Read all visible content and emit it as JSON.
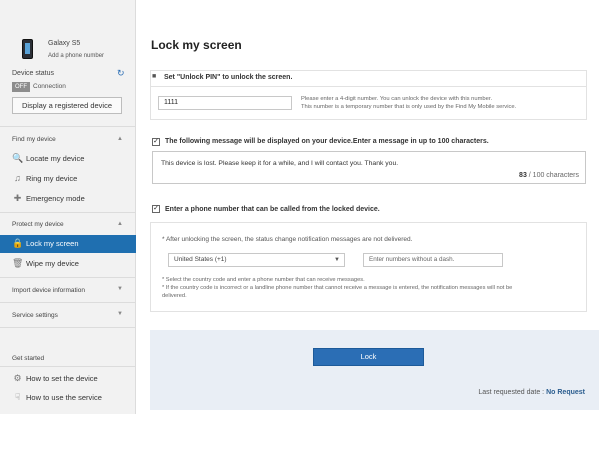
{
  "sidebar": {
    "device_name": "Galaxy S5",
    "add_phone": "Add a phone number",
    "status_label": "Device status",
    "status_badge": "OFF",
    "status_text": "Connection",
    "display_button": "Display a registered device",
    "find": {
      "title": "Find my device",
      "items": [
        {
          "label": "Locate my device",
          "icon": "search-icon"
        },
        {
          "label": "Ring my device",
          "icon": "music-note-icon"
        },
        {
          "label": "Emergency mode",
          "icon": "emergency-icon"
        }
      ]
    },
    "protect": {
      "title": "Protect my device",
      "items": [
        {
          "label": "Lock my screen",
          "icon": "lock-icon",
          "active": true
        },
        {
          "label": "Wipe my device",
          "icon": "trash-icon"
        }
      ]
    },
    "import_title": "Import device information",
    "service_title": "Service settings",
    "get_started": {
      "title": "Get started",
      "items": [
        {
          "label": "How to set the device",
          "icon": "gear-icon"
        },
        {
          "label": "How to use the service",
          "icon": "hand-icon"
        }
      ]
    }
  },
  "main": {
    "title": "Lock my screen",
    "pin": {
      "heading": "Set \"Unlock PIN\" to unlock the screen.",
      "value": "1111",
      "hint1": "Please enter a 4-digit number. You can unlock the device with this number.",
      "hint2": "This number is a temporary number that is only used by the Find My Mobile service."
    },
    "message": {
      "label": "The following message will be displayed on your device.Enter a message in up to 100 characters.",
      "text": "This device is lost. Please keep it for a while, and I will contact you. Thank you.",
      "count": "83",
      "count_suffix": "/ 100 characters"
    },
    "phone": {
      "label": "Enter a phone number that can be called from the locked device.",
      "note": "* After unlocking the screen, the status change notification messages are not delivered.",
      "country": "United States (+1)",
      "phone_placeholder": "Enter numbers without a dash.",
      "fine1": "* Select the country code and enter a phone number that can receive messages.",
      "fine2": "* If the country code is incorrect or a landline phone number that cannot receive a message is entered, the notification messages will not be",
      "fine3": "delivered."
    },
    "lock_button": "Lock",
    "last_requested_label": "Last requested date :",
    "last_requested_value": "No Request"
  },
  "colors": {
    "accent": "#2b6eb5",
    "active_nav": "#1f6fb0",
    "lock_panel": "#e9eef5"
  }
}
